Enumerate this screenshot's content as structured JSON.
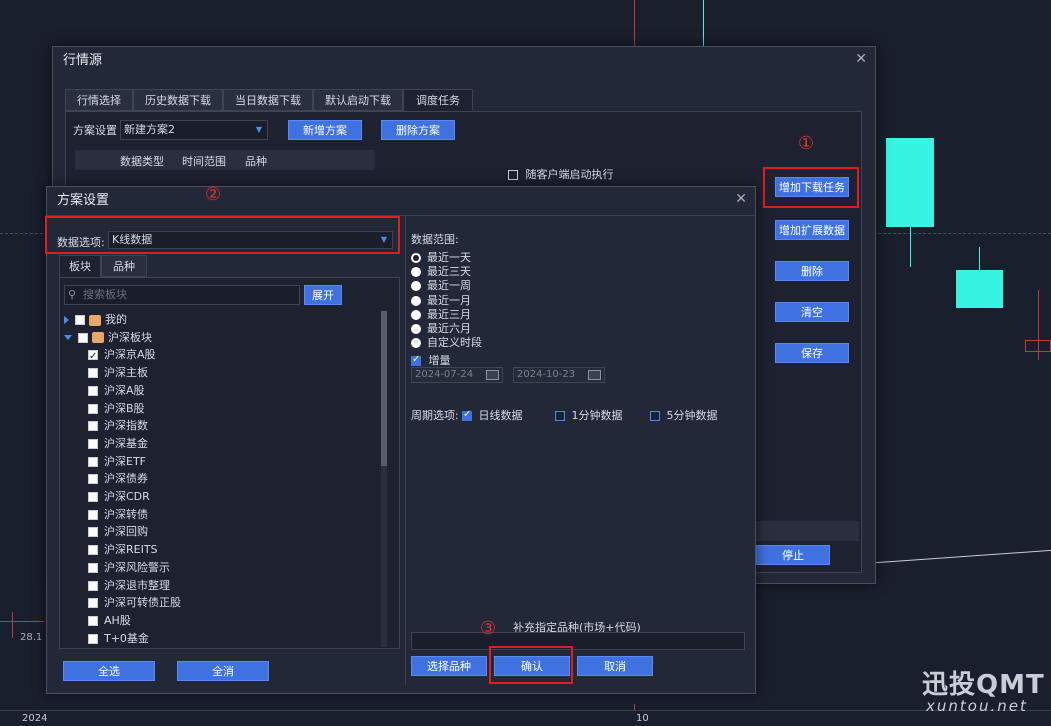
{
  "brand": {
    "name": "迅投QMT",
    "url": "xuntou.net"
  },
  "axis": {
    "left_date": "2024",
    "mid_date": "10",
    "price_label": "28.1"
  },
  "main_window": {
    "title": "行情源",
    "tabs": [
      "行情选择",
      "历史数据下载",
      "当日数据下载",
      "默认启动下载",
      "调度任务"
    ],
    "scheme_label": "方案设置",
    "scheme_value": "新建方案2",
    "new_scheme": "新增方案",
    "delete_scheme": "删除方案",
    "columns": [
      "数据类型",
      "时间范围",
      "品种"
    ],
    "autorun_label": "随客户端启动执行",
    "side_buttons": {
      "add_download": "增加下载任务",
      "add_extended": "增加扩展数据",
      "delete": "删除",
      "clear": "清空",
      "save": "保存"
    },
    "stop": "停止"
  },
  "annotations": {
    "one": "①",
    "two": "②",
    "three": "③"
  },
  "dialog": {
    "title": "方案设置",
    "data_option_label": "数据选项:",
    "data_option_value": "K线数据",
    "tabs": [
      "板块",
      "品种"
    ],
    "search_placeholder": "搜索板块",
    "expand": "展开",
    "tree": [
      {
        "label": "我的",
        "level": 0,
        "expanded": false,
        "checked": false
      },
      {
        "label": "沪深板块",
        "level": 0,
        "expanded": true,
        "checked": false
      },
      {
        "label": "沪深京A股",
        "level": 1,
        "checked": true
      },
      {
        "label": "沪深主板",
        "level": 1,
        "checked": false
      },
      {
        "label": "沪深A股",
        "level": 1,
        "checked": false
      },
      {
        "label": "沪深B股",
        "level": 1,
        "checked": false
      },
      {
        "label": "沪深指数",
        "level": 1,
        "checked": false
      },
      {
        "label": "沪深基金",
        "level": 1,
        "checked": false
      },
      {
        "label": "沪深ETF",
        "level": 1,
        "checked": false
      },
      {
        "label": "沪深债券",
        "level": 1,
        "checked": false
      },
      {
        "label": "沪深CDR",
        "level": 1,
        "checked": false
      },
      {
        "label": "沪深转债",
        "level": 1,
        "checked": false
      },
      {
        "label": "沪深回购",
        "level": 1,
        "checked": false
      },
      {
        "label": "沪深REITS",
        "level": 1,
        "checked": false
      },
      {
        "label": "沪深风险警示",
        "level": 1,
        "checked": false
      },
      {
        "label": "沪深退市整理",
        "level": 1,
        "checked": false
      },
      {
        "label": "沪深可转债正股",
        "level": 1,
        "checked": false
      },
      {
        "label": "AH股",
        "level": 1,
        "checked": false
      },
      {
        "label": "T+0基金",
        "level": 1,
        "checked": false
      }
    ],
    "select_all": "全选",
    "deselect_all": "全消",
    "range_title": "数据范围:",
    "ranges": [
      "最近一天",
      "最近三天",
      "最近一周",
      "最近一月",
      "最近三月",
      "最近六月",
      "自定义时段"
    ],
    "incremental": "增量",
    "date_from": "2024-07-24",
    "date_to": "2024-10-23",
    "period_label": "周期选项:",
    "periods": [
      "日线数据",
      "1分钟数据",
      "5分钟数据"
    ],
    "supplement_label": "补充指定品种(市场+代码)",
    "choose_symbol": "选择品种",
    "confirm": "确认",
    "cancel": "取消"
  }
}
